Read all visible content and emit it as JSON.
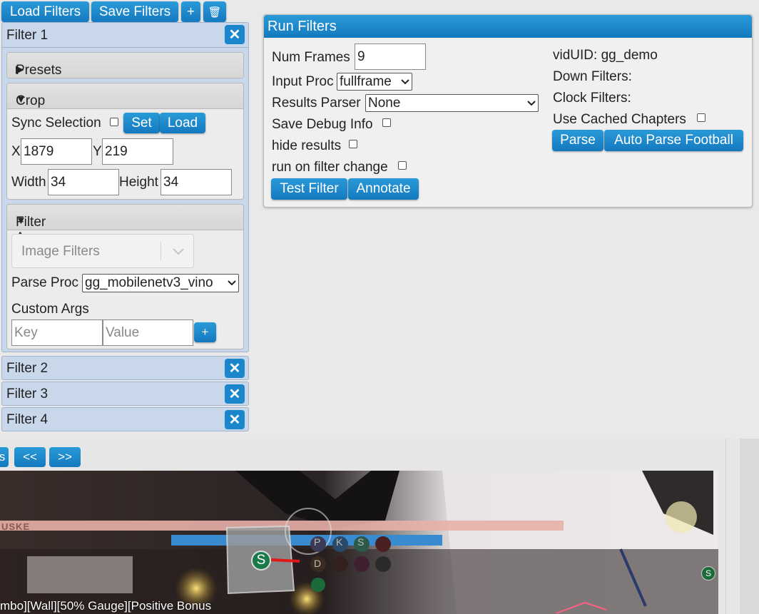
{
  "toolbar": {
    "load_filters": "Load Filters",
    "save_filters": "Save Filters",
    "add": "+",
    "delete": "🗑"
  },
  "filters": [
    {
      "title": "Filter 1",
      "close": "✕"
    },
    {
      "title": "Filter 2",
      "close": "✕"
    },
    {
      "title": "Filter 3",
      "close": "✕"
    },
    {
      "title": "Filter 4",
      "close": "✕"
    }
  ],
  "presets": {
    "label": "Presets",
    "arrow": "▶"
  },
  "crop": {
    "label": "Crop",
    "arrow": "▼",
    "sync_selection": "Sync Selection",
    "set": "Set",
    "load": "Load",
    "x_label": "X",
    "x_value": "1879",
    "y_label": "Y",
    "y_value": "219",
    "width_label": "Width",
    "width_value": "34",
    "height_label": "Height",
    "height_value": "34"
  },
  "filter_args": {
    "label": "Filter Args",
    "arrow": "▼",
    "image_filters_placeholder": "Image Filters",
    "parse_proc_label": "Parse Proc",
    "parse_proc_value": "gg_mobilenetv3_vino",
    "custom_args_label": "Custom Args",
    "key_placeholder": "Key",
    "value_placeholder": "Value",
    "add": "+"
  },
  "run_filters": {
    "title": "Run Filters",
    "num_frames_label": "Num Frames",
    "num_frames_value": "9",
    "input_proc_label": "Input Proc",
    "input_proc_value": "fullframe",
    "results_parser_label": "Results Parser",
    "results_parser_value": "None",
    "save_debug_label": "Save Debug Info",
    "hide_results_label": "hide results",
    "run_on_change_label": "run on filter change",
    "test_filter": "Test Filter",
    "annotate": "Annotate",
    "viduid": "vidUID: gg_demo",
    "down_filters": "Down Filters:",
    "clock_filters": "Clock Filters:",
    "use_cached_label": "Use Cached Chapters",
    "parse": "Parse",
    "auto_parse": "Auto Parse Football"
  },
  "player": {
    "prev_partial": "s",
    "rewind": "<<",
    "forward": ">>"
  },
  "video": {
    "caption": "mbo][Wall][50% Gauge][Positive Bonus",
    "hud_name": "USKE",
    "token_s": "S",
    "icons": [
      "P",
      "K",
      "S",
      "D"
    ]
  },
  "colors": {
    "accent": "#1b86cc",
    "filter_bg": "#c8d7ea"
  }
}
